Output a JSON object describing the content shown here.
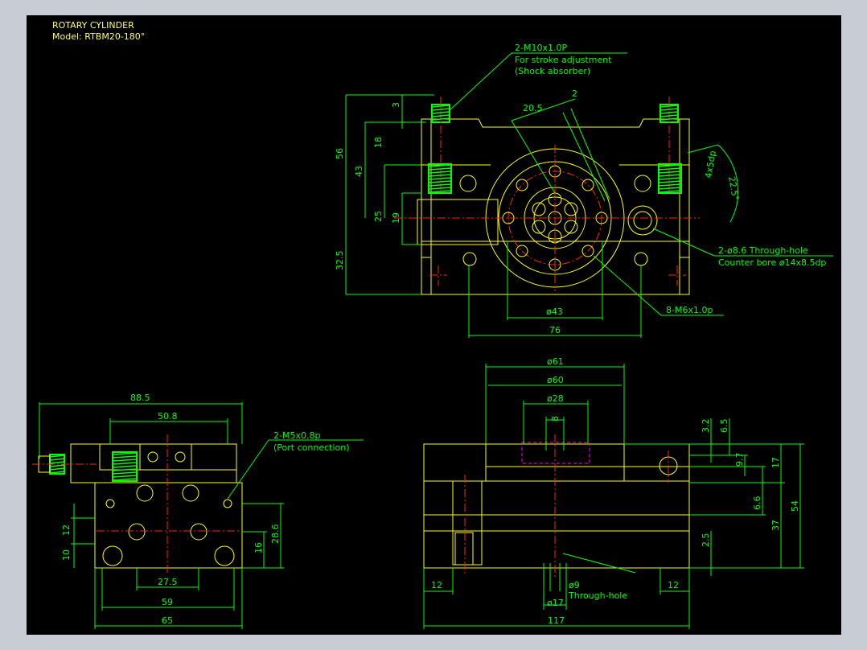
{
  "colors": {
    "frame_bg": "#c8ccd4",
    "drawing_bg": "#000000",
    "dimension": "#00ff00",
    "part": "#ffff00",
    "centerline": "#ff2020",
    "hidden": "#ff00ff",
    "title_text": "#ffff66"
  },
  "title": {
    "line1": "ROTARY CYLINDER",
    "line2": "Model: RTBM20-180°"
  },
  "top_view": {
    "callout_port_1": "2-M10x1.0P",
    "callout_port_2": "For stroke adjustment",
    "callout_port_3": "(Shock absorber)",
    "callout_hole_1": "2-ø8.6 Through-hole",
    "callout_hole_2": "Counter bore ø14x8.5dp",
    "callout_tap": "8-M6x1.0p",
    "dims": {
      "d3": "3",
      "d56": "56",
      "d43": "43",
      "d18": "18",
      "d25": "25",
      "d19": "19",
      "d32_5": "32.5",
      "d20_5": "20.5",
      "d2": "2",
      "d4x5dp": "4x5dp",
      "d22_5": "22.5°",
      "dphi43": "ø43",
      "d76": "76"
    }
  },
  "side_view": {
    "callout_1": "2-M5x0.8p",
    "callout_2": "(Port connection)",
    "dims": {
      "d88_5": "88.5",
      "d50_8": "50.8",
      "d12": "12",
      "d10": "10",
      "d28_6": "28.6",
      "d16": "16",
      "d27_5": "27.5",
      "d59": "59",
      "d65": "65"
    }
  },
  "front_view": {
    "through_hole": "Through-hole",
    "dims": {
      "phi61": "ø61",
      "phi60": "ø60",
      "phi28": "ø28",
      "d8": "8",
      "d3_2": "3.2",
      "d6_5": "6.5",
      "d9_7": "9.7",
      "d17": "17",
      "d6_6": "6.6",
      "d54": "54",
      "d37": "37",
      "d2_5": "2.5",
      "d12a": "12",
      "d12b": "12",
      "phi9": "ø9",
      "phi17": "ø17",
      "d117": "117"
    }
  }
}
